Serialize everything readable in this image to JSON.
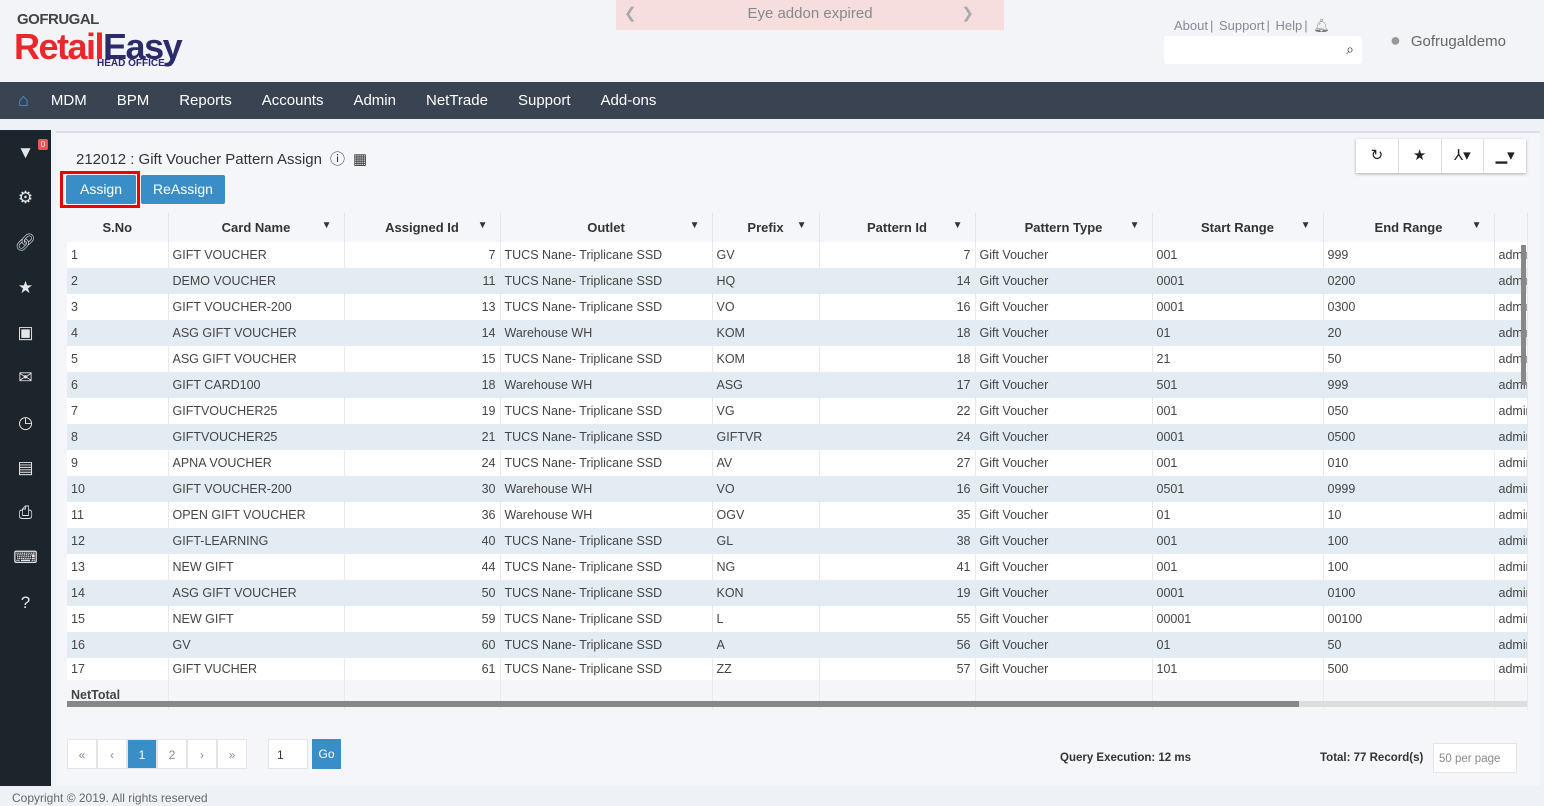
{
  "brand": {
    "line1": "GOFRUGAL",
    "retail": "Retail",
    "easy": "Easy",
    "sub": "HEAD OFFICE"
  },
  "banner": "Eye addon expired",
  "top_links": [
    "About",
    "Support",
    "Help"
  ],
  "search": {
    "placeholder": ""
  },
  "user": "Gofrugaldemo",
  "nav": [
    "MDM",
    "BPM",
    "Reports",
    "Accounts",
    "Admin",
    "NetTrade",
    "Support",
    "Add-ons"
  ],
  "filter_badge": "0",
  "page": {
    "title": "212012 : Gift Voucher Pattern Assign",
    "assign": "Assign",
    "reassign": "ReAssign"
  },
  "table": {
    "columns": [
      "S.No",
      "Card Name",
      "Assigned Id",
      "Outlet",
      "Prefix",
      "Pattern Id",
      "Pattern Type",
      "Start Range",
      "End Range",
      ""
    ],
    "rows": [
      [
        "1",
        "GIFT VOUCHER",
        "7",
        "TUCS Nane- Triplicane SSD",
        "GV",
        "7",
        "Gift Voucher",
        "001",
        "999",
        "admin"
      ],
      [
        "2",
        "DEMO VOUCHER",
        "11",
        "TUCS Nane- Triplicane SSD",
        "HQ",
        "14",
        "Gift Voucher",
        "0001",
        "0200",
        "admin"
      ],
      [
        "3",
        "GIFT VOUCHER-200",
        "13",
        "TUCS Nane- Triplicane SSD",
        "VO",
        "16",
        "Gift Voucher",
        "0001",
        "0300",
        "admin"
      ],
      [
        "4",
        "ASG GIFT VOUCHER",
        "14",
        "Warehouse WH",
        "KOM",
        "18",
        "Gift Voucher",
        "01",
        "20",
        "admin"
      ],
      [
        "5",
        "ASG GIFT VOUCHER",
        "15",
        "TUCS Nane- Triplicane SSD",
        "KOM",
        "18",
        "Gift Voucher",
        "21",
        "50",
        "admin"
      ],
      [
        "6",
        "GIFT CARD100",
        "18",
        "Warehouse WH",
        "ASG",
        "17",
        "Gift Voucher",
        "501",
        "999",
        "admin"
      ],
      [
        "7",
        "GIFTVOUCHER25",
        "19",
        "TUCS Nane- Triplicane SSD",
        "VG",
        "22",
        "Gift Voucher",
        "001",
        "050",
        "admin"
      ],
      [
        "8",
        "GIFTVOUCHER25",
        "21",
        "TUCS Nane- Triplicane SSD",
        "GIFTVR",
        "24",
        "Gift Voucher",
        "0001",
        "0500",
        "admin"
      ],
      [
        "9",
        "APNA VOUCHER",
        "24",
        "TUCS Nane- Triplicane SSD",
        "AV",
        "27",
        "Gift Voucher",
        "001",
        "010",
        "admin"
      ],
      [
        "10",
        "GIFT VOUCHER-200",
        "30",
        "Warehouse WH",
        "VO",
        "16",
        "Gift Voucher",
        "0501",
        "0999",
        "admin"
      ],
      [
        "11",
        "OPEN GIFT VOUCHER",
        "36",
        "Warehouse WH",
        "OGV",
        "35",
        "Gift Voucher",
        "01",
        "10",
        "admin"
      ],
      [
        "12",
        "GIFT-LEARNING",
        "40",
        "TUCS Nane- Triplicane SSD",
        "GL",
        "38",
        "Gift Voucher",
        "001",
        "100",
        "admin"
      ],
      [
        "13",
        "NEW GIFT",
        "44",
        "TUCS Nane- Triplicane SSD",
        "NG",
        "41",
        "Gift Voucher",
        "001",
        "100",
        "admin"
      ],
      [
        "14",
        "ASG GIFT VOUCHER",
        "50",
        "TUCS Nane- Triplicane SSD",
        "KON",
        "19",
        "Gift Voucher",
        "0001",
        "0100",
        "admin"
      ],
      [
        "15",
        "NEW GIFT",
        "59",
        "TUCS Nane- Triplicane SSD",
        "L",
        "55",
        "Gift Voucher",
        "00001",
        "00100",
        "admin"
      ],
      [
        "16",
        "GV",
        "60",
        "TUCS Nane- Triplicane SSD",
        "A",
        "56",
        "Gift Voucher",
        "01",
        "50",
        "admin"
      ],
      [
        "17",
        "GIFT VUCHER",
        "61",
        "TUCS Nane- Triplicane SSD",
        "ZZ",
        "57",
        "Gift Voucher",
        "101",
        "500",
        "admin"
      ]
    ],
    "footer": "NetTotal"
  },
  "pager": {
    "first": "«",
    "prev": "‹",
    "pages": [
      "1",
      "2"
    ],
    "current": "1",
    "next": "›",
    "last": "»",
    "goto_value": "1",
    "go": "Go"
  },
  "query": "Query Execution: 12 ms",
  "total": "Total: 77 Record(s)",
  "per_page": "50 per page",
  "copyright": "Copyright © 2019. All rights reserved"
}
